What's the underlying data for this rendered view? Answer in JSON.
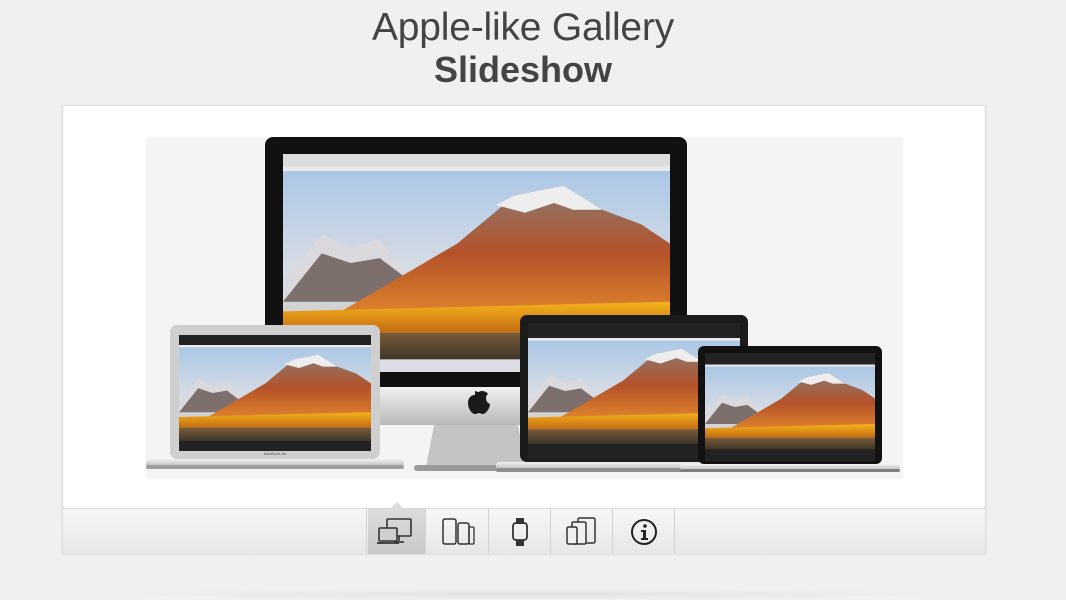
{
  "header": {
    "title": "Apple-like Gallery",
    "subtitle": "Slideshow"
  },
  "slide": {
    "current_index": 0,
    "device_screen_brand": "MacBook Air",
    "device_screen_brand_small": "MacBook"
  },
  "nav": {
    "items": [
      {
        "icon": "desktop-laptop-icon",
        "active": true
      },
      {
        "icon": "phones-icon",
        "active": false
      },
      {
        "icon": "watch-icon",
        "active": false
      },
      {
        "icon": "tablets-icon",
        "active": false
      },
      {
        "icon": "info-icon",
        "active": false
      }
    ]
  },
  "colors": {
    "background": "#f0f0f0",
    "title_text": "#444444",
    "active_tab": "#cfcfcf"
  }
}
